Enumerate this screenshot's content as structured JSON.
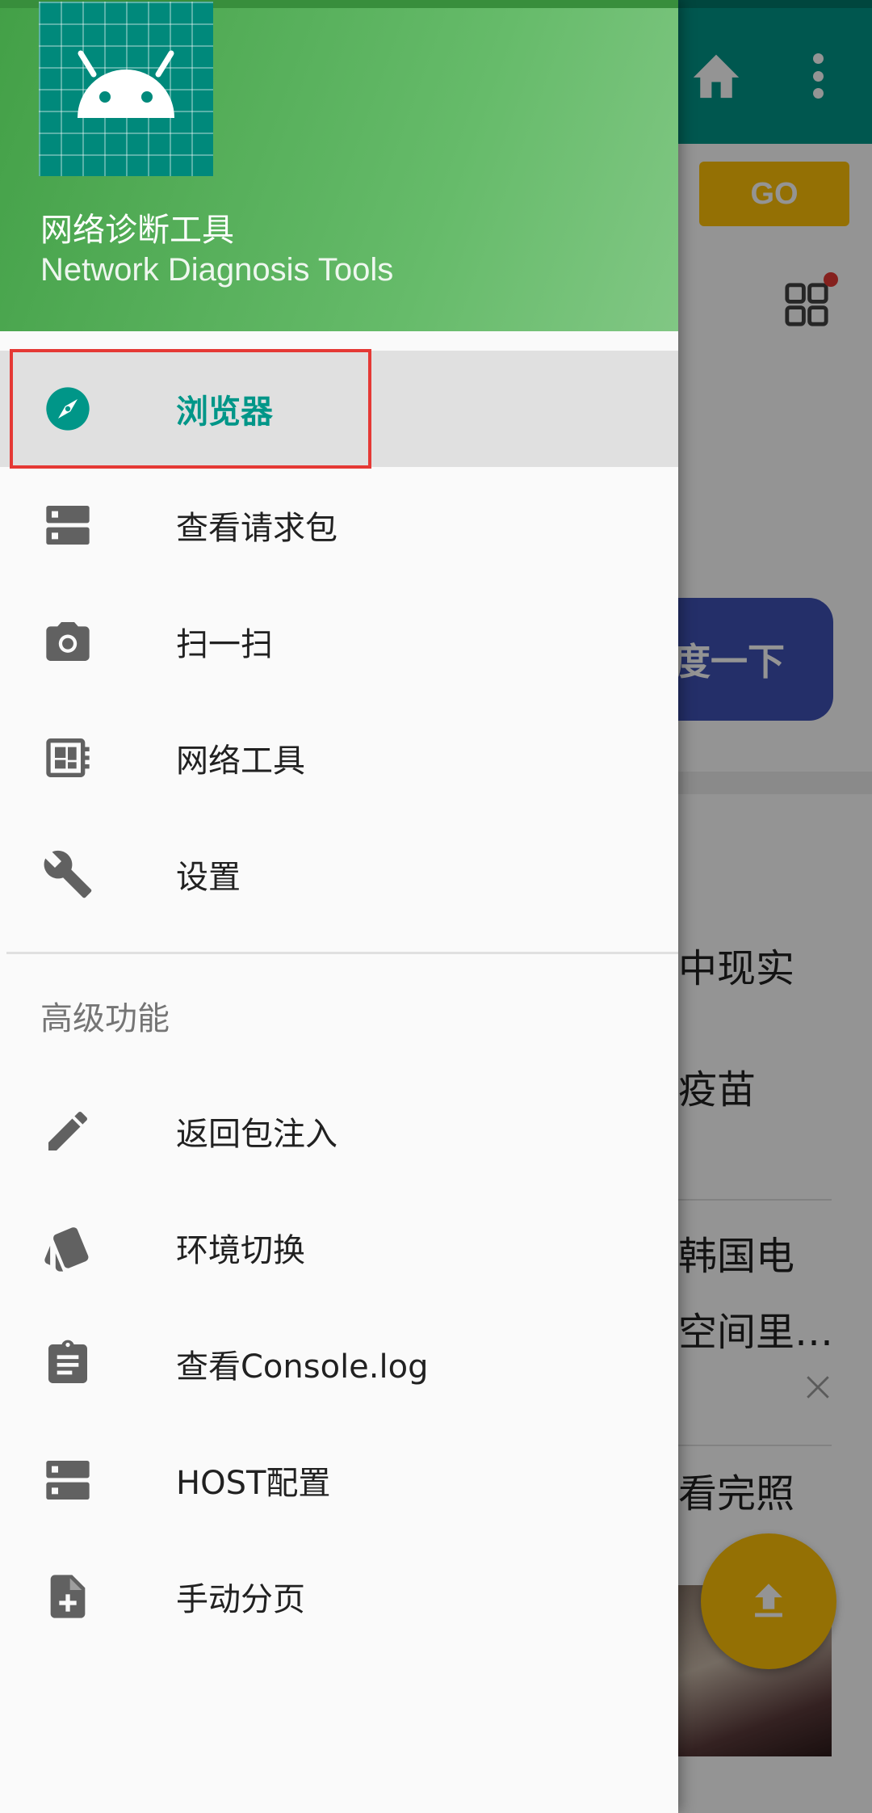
{
  "drawer": {
    "title": "网络诊断工具",
    "subtitle": "Network Diagnosis Tools",
    "primary_items": [
      {
        "label": "浏览器",
        "icon": "compass-icon",
        "active": true
      },
      {
        "label": "查看请求包",
        "icon": "storage-icon"
      },
      {
        "label": "扫一扫",
        "icon": "camera-icon"
      },
      {
        "label": "网络工具",
        "icon": "developer-board-icon"
      },
      {
        "label": "设置",
        "icon": "wrench-icon"
      }
    ],
    "advanced_section_title": "高级功能",
    "advanced_items": [
      {
        "label": "返回包注入",
        "icon": "pencil-icon"
      },
      {
        "label": "环境切换",
        "icon": "cards-icon"
      },
      {
        "label": "查看Console.log",
        "icon": "clipboard-icon"
      },
      {
        "label": "HOST配置",
        "icon": "storage-icon"
      },
      {
        "label": "手动分页",
        "icon": "file-plus-icon"
      }
    ]
  },
  "background": {
    "go_button": "GO",
    "search_button": "度一下",
    "news": [
      "中现实",
      "疫苗",
      "韩国电",
      "空间里…",
      "看完照"
    ]
  },
  "colors": {
    "accent": "#009688",
    "header_green": "#4caf50",
    "highlight_red": "#e53935",
    "go_yellow": "#ffc107",
    "search_blue": "#3f51b5"
  }
}
